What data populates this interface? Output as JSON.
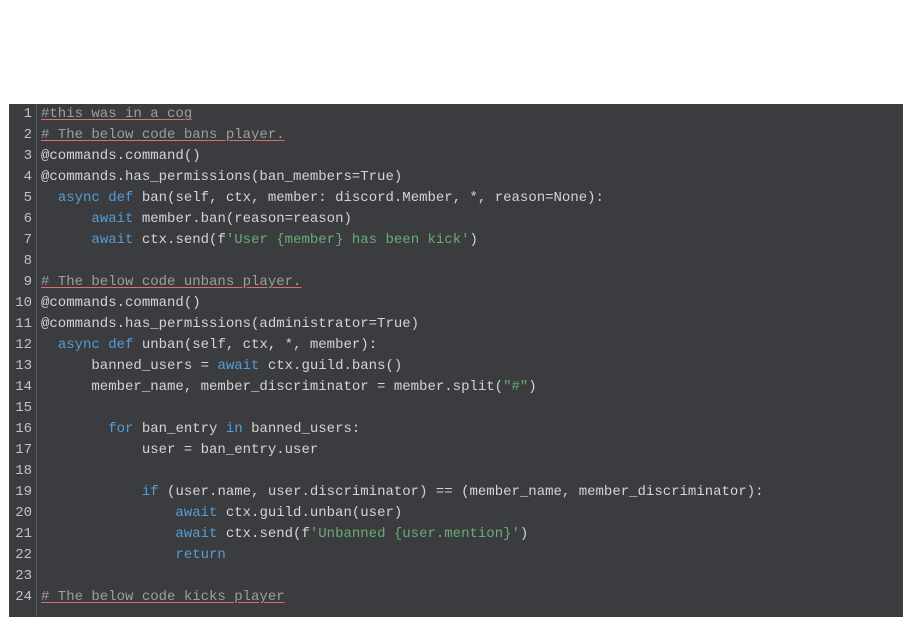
{
  "editor": {
    "language": "python",
    "theme": "dark",
    "lines": [
      {
        "num": 1,
        "tokens": [
          [
            "comment",
            "#this was in a cog"
          ]
        ]
      },
      {
        "num": 2,
        "tokens": [
          [
            "comment",
            "# The below code bans player."
          ]
        ]
      },
      {
        "num": 3,
        "tokens": [
          [
            "plain",
            "@commands.command()"
          ]
        ]
      },
      {
        "num": 4,
        "tokens": [
          [
            "plain",
            "@commands.has_permissions(ban_members=True)"
          ]
        ]
      },
      {
        "num": 5,
        "tokens": [
          [
            "plain",
            "  "
          ],
          [
            "async",
            "async"
          ],
          [
            "plain",
            " "
          ],
          [
            "keyword",
            "def"
          ],
          [
            "plain",
            " ban(self, ctx, member: discord.Member, *, reason=None):"
          ]
        ]
      },
      {
        "num": 6,
        "tokens": [
          [
            "plain",
            "      "
          ],
          [
            "await",
            "await"
          ],
          [
            "plain",
            " member.ban(reason=reason)"
          ]
        ]
      },
      {
        "num": 7,
        "tokens": [
          [
            "plain",
            "      "
          ],
          [
            "await",
            "await"
          ],
          [
            "plain",
            " ctx.send(f"
          ],
          [
            "string",
            "'User {member} has been kick'"
          ],
          [
            "plain",
            ")"
          ]
        ]
      },
      {
        "num": 8,
        "tokens": []
      },
      {
        "num": 9,
        "tokens": [
          [
            "comment",
            "# The below code unbans player."
          ]
        ]
      },
      {
        "num": 10,
        "tokens": [
          [
            "plain",
            "@commands.command()"
          ]
        ]
      },
      {
        "num": 11,
        "tokens": [
          [
            "plain",
            "@commands.has_permissions(administrator=True)"
          ]
        ]
      },
      {
        "num": 12,
        "tokens": [
          [
            "plain",
            "  "
          ],
          [
            "async",
            "async"
          ],
          [
            "plain",
            " "
          ],
          [
            "keyword",
            "def"
          ],
          [
            "plain",
            " unban(self, ctx, *, member):"
          ]
        ]
      },
      {
        "num": 13,
        "tokens": [
          [
            "plain",
            "      banned_users = "
          ],
          [
            "await",
            "await"
          ],
          [
            "plain",
            " ctx.guild.bans()"
          ]
        ]
      },
      {
        "num": 14,
        "tokens": [
          [
            "plain",
            "      member_name, member_discriminator = member.split("
          ],
          [
            "string",
            "\"#\""
          ],
          [
            "plain",
            ")"
          ]
        ]
      },
      {
        "num": 15,
        "tokens": []
      },
      {
        "num": 16,
        "tokens": [
          [
            "plain",
            "        "
          ],
          [
            "for",
            "for"
          ],
          [
            "plain",
            " ban_entry "
          ],
          [
            "in",
            "in"
          ],
          [
            "plain",
            " banned_users:"
          ]
        ]
      },
      {
        "num": 17,
        "tokens": [
          [
            "plain",
            "            user = ban_entry.user"
          ]
        ]
      },
      {
        "num": 18,
        "tokens": []
      },
      {
        "num": 19,
        "tokens": [
          [
            "plain",
            "            "
          ],
          [
            "if",
            "if"
          ],
          [
            "plain",
            " (user.name, user.discriminator) == (member_name, member_discriminator):"
          ]
        ]
      },
      {
        "num": 20,
        "tokens": [
          [
            "plain",
            "                "
          ],
          [
            "await",
            "await"
          ],
          [
            "plain",
            " ctx.guild.unban(user)"
          ]
        ]
      },
      {
        "num": 21,
        "tokens": [
          [
            "plain",
            "                "
          ],
          [
            "await",
            "await"
          ],
          [
            "plain",
            " ctx.send(f"
          ],
          [
            "string",
            "'Unbanned {user.mention}'"
          ],
          [
            "plain",
            ")"
          ]
        ]
      },
      {
        "num": 22,
        "tokens": [
          [
            "plain",
            "                "
          ],
          [
            "return",
            "return"
          ]
        ]
      },
      {
        "num": 23,
        "tokens": []
      },
      {
        "num": 24,
        "tokens": [
          [
            "comment",
            "# The below code kicks player"
          ]
        ]
      }
    ]
  }
}
